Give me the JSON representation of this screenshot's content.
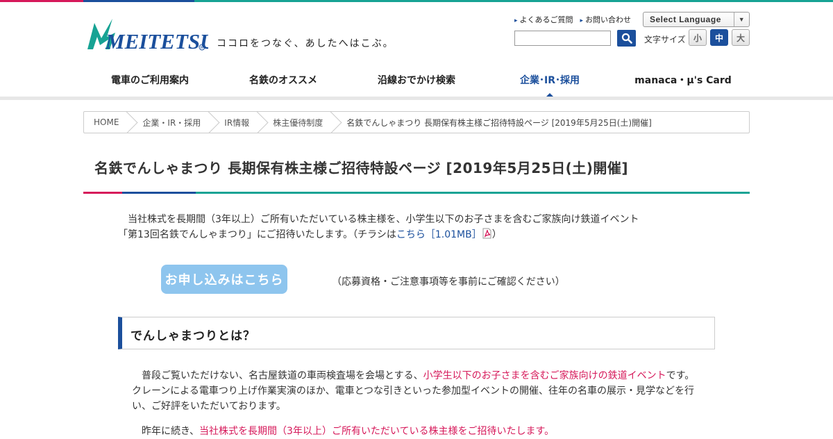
{
  "colors": {
    "brand_blue": "#1b4f9c",
    "teal": "#17a394",
    "red": "#d6195a",
    "apply_button": "#8ec5ee"
  },
  "header": {
    "tagline": "ココロをつなぐ、あしたへはこぶ。",
    "logo_text": "MEITETSU",
    "links": [
      "よくあるご質問",
      "お問い合わせ"
    ],
    "language_select": "Select Language",
    "search": {
      "value": "",
      "placeholder": ""
    },
    "font_size_label": "文字サイズ",
    "font_sizes": [
      "小",
      "中",
      "大"
    ],
    "font_size_active": "中"
  },
  "nav": {
    "items": [
      "電車のご利用案内",
      "名鉄のオススメ",
      "沿線おでかけ検索",
      "企業･IR･採用",
      "manaca・μ's Card"
    ],
    "active": "企業･IR･採用"
  },
  "breadcrumb": [
    "HOME",
    "企業・IR・採用",
    "IR情報",
    "株主優待制度",
    "名鉄でんしゃまつり 長期保有株主様ご招待特設ページ [2019年5月25日(土)開催]"
  ],
  "page_title": "名鉄でんしゃまつり 長期保有株主様ご招待特設ページ [2019年5月25日(土)開催]",
  "intro": {
    "line1": "当社株式を長期間（3年以上）ご所有いただいている株主様を、小学生以下のお子さまを含むご家族向け鉄道イベント",
    "line2_before": "「第13回名鉄でんしゃまつり」にご招待いたします。（チラシは",
    "line2_link": "こちら［1.01MB］",
    "line2_after": "）"
  },
  "apply": {
    "button": "お申し込みはこちら",
    "note": "（応募資格・ご注意事項等を事前にご確認ください）"
  },
  "section": {
    "heading": "でんしゃまつりとは？",
    "p1_before": "普段ご覧いただけない、名古屋鉄道の車両検査場を会場とする、",
    "p1_highlight": "小学生以下のお子さまを含むご家族向けの鉄道イベント",
    "p1_after": "です。クレーンによる電車つり上げ作業実演のほか、電車とつな引きといった参加型イベントの開催、往年の名車の展示・見学などを行い、ご好評をいただいております。",
    "p2_before": "昨年に続き、",
    "p2_highlight": "当社株式を長期間（3年以上）ご所有いただいている株主様をご招待いたします。"
  }
}
